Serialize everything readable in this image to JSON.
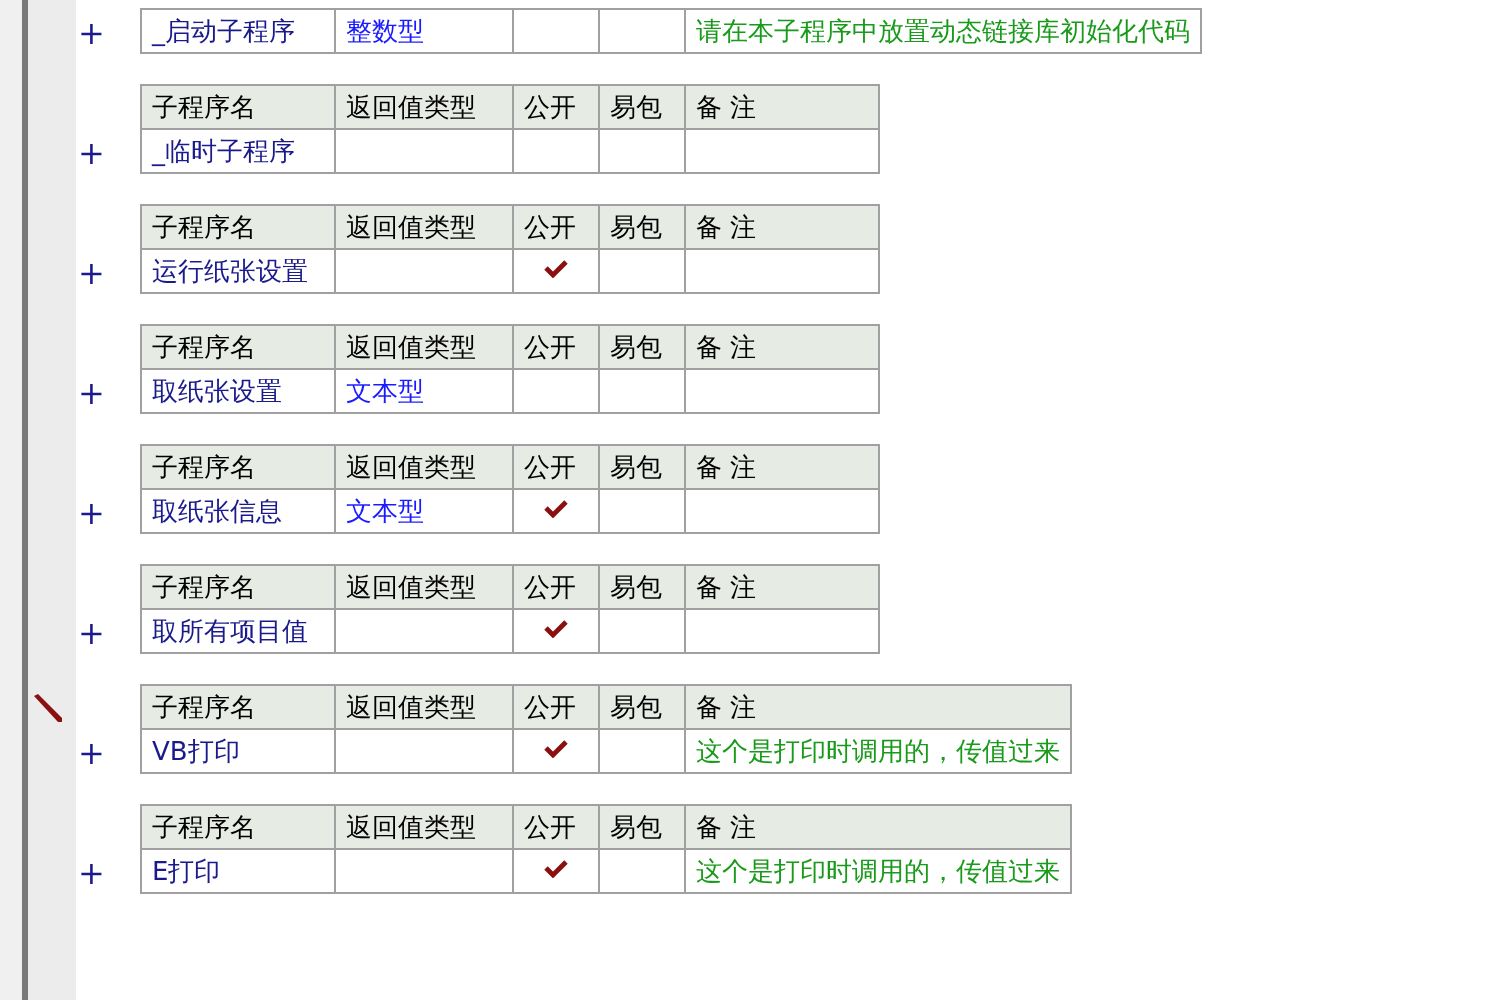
{
  "subroutines": [
    {
      "expander": "+",
      "name": "_启动子程序",
      "return_type": "整数型",
      "public": false,
      "marked": false,
      "comment": "请在本子程序中放置动态链接库初始化代码"
    },
    {
      "columns": [
        "子程序名",
        "返回值类型",
        "公开",
        "易包",
        "备 注"
      ],
      "expander": "+",
      "name": "_临时子程序",
      "public": false,
      "marked": false
    },
    {
      "columns": [
        "子程序名",
        "返回值类型",
        "公开",
        "易包",
        "备 注"
      ],
      "expander": "+",
      "name": "运行纸张设置",
      "public": true,
      "marked": false
    },
    {
      "columns": [
        "子程序名",
        "返回值类型",
        "公开",
        "易包",
        "备 注"
      ],
      "expander": "+",
      "name": "取纸张设置",
      "return_type": "文本型",
      "public": false,
      "marked": false
    },
    {
      "columns": [
        "子程序名",
        "返回值类型",
        "公开",
        "易包",
        "备 注"
      ],
      "expander": "+",
      "name": "取纸张信息",
      "return_type": "文本型",
      "public": true,
      "marked": false
    },
    {
      "columns": [
        "子程序名",
        "返回值类型",
        "公开",
        "易包",
        "备 注"
      ],
      "expander": "+",
      "name": "取所有项目值",
      "public": true,
      "marked": false
    },
    {
      "columns": [
        "子程序名",
        "返回值类型",
        "公开",
        "易包",
        "备 注"
      ],
      "expander": "+",
      "name": "VB打印",
      "public": true,
      "marked": true,
      "comment": "这个是打印时调用的，传值过来"
    },
    {
      "columns": [
        "子程序名",
        "返回值类型",
        "公开",
        "易包",
        "备 注"
      ],
      "expander": "+",
      "name": "E打印",
      "public": true,
      "marked": false,
      "comment": "这个是打印时调用的，传值过来"
    }
  ]
}
